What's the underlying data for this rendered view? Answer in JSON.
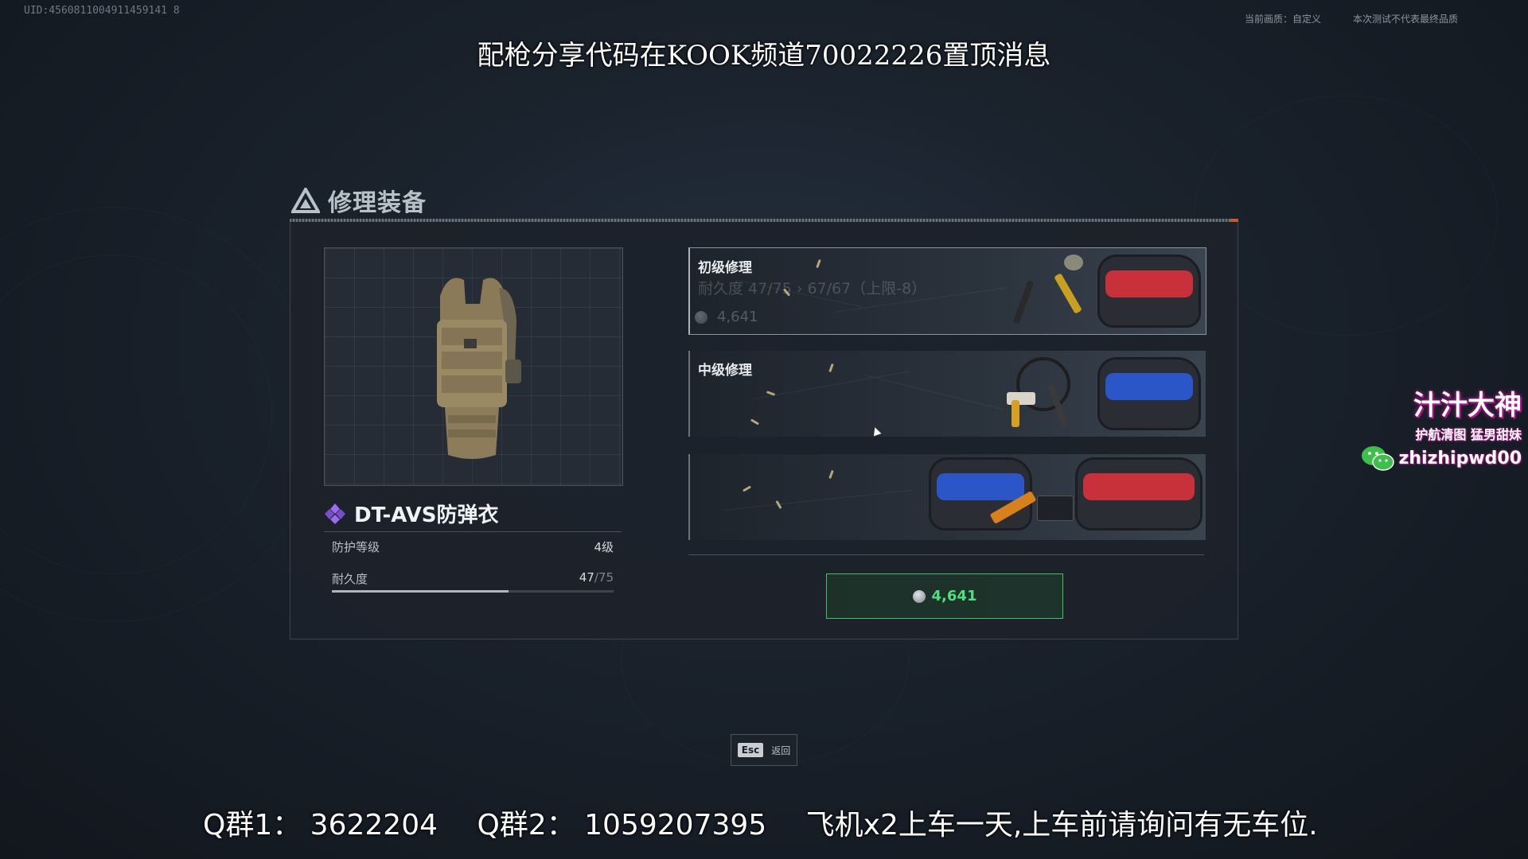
{
  "hud": {
    "uid": "UID:4560811004911459141 8",
    "quality": "当前画质：自定义",
    "disclaimer": "本次测试不代表最终品质"
  },
  "overlays": {
    "top": "配枪分享代码在KOOK频道70022226置顶消息",
    "qq1": "Q群1： 3622204",
    "qq2": "Q群2： 1059207395",
    "note": "飞机x2上车一天,上车前请询问有无车位."
  },
  "panel": {
    "title": "修理装备"
  },
  "item": {
    "name": "DT-AVS防弹衣",
    "protection_label": "防护等级",
    "protection_value": "4级",
    "durability_label": "耐久度",
    "durability_current": "47",
    "durability_max": "/75",
    "durability_fraction": 0.627
  },
  "repair_options": [
    {
      "label": "初级修理",
      "sub": "耐久度 47/75 › 67/67（上限-8）",
      "cost": "4,641",
      "selected": true
    },
    {
      "label": "中级修理",
      "selected": false
    },
    {
      "label": "",
      "selected": false
    }
  ],
  "confirm": {
    "cost": "4,641"
  },
  "esc": {
    "key": "Esc",
    "label": "返回"
  },
  "watermark": {
    "name": "汁汁大神",
    "tag": "护航清图 猛男甜妹",
    "id": "zhizhipwd00"
  },
  "colors": {
    "accent_green": "#4fe07e",
    "rarity_purple": "#8a5cd8",
    "header_mark": "#c85a2a"
  }
}
